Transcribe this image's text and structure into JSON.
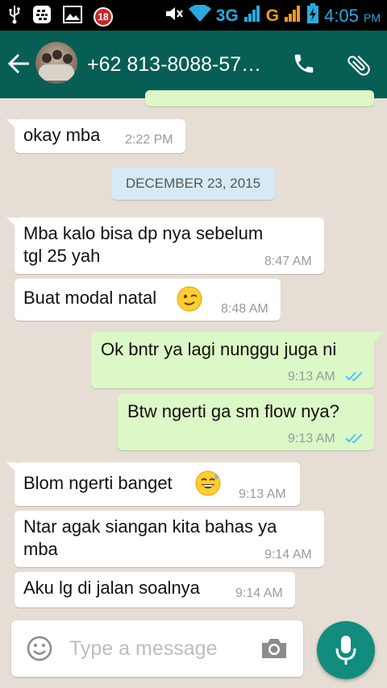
{
  "statusbar": {
    "notification_count": "18",
    "network_type_1": "3G",
    "network_type_2": "G",
    "time": "4:05",
    "ampm": "PM"
  },
  "header": {
    "contact_name": "+62 813-8088-57…"
  },
  "chat": {
    "date_separator": "DECEMBER 23, 2015",
    "messages": [
      {
        "text": "okay mba",
        "time": "2:22 PM"
      },
      {
        "text_line1": "Mba kalo bisa dp nya sebelum",
        "text_line2": "tgl 25 yah",
        "time": "8:47 AM"
      },
      {
        "text": "Buat modal natal",
        "emoji": "😉",
        "time": "8:48 AM"
      },
      {
        "text": "Ok bntr ya lagi nunggu juga ni",
        "time": "9:13 AM"
      },
      {
        "text": "Btw ngerti ga sm flow nya?",
        "time": "9:13 AM"
      },
      {
        "text": "Blom ngerti banget",
        "emoji": "😅",
        "time": "9:13 AM"
      },
      {
        "text_line1": "Ntar agak siangan kita bahas ya",
        "text_line2": "mba",
        "time": "9:14 AM"
      },
      {
        "text": "Aku lg di jalan soalnya",
        "time": "9:14 AM"
      }
    ]
  },
  "composer": {
    "placeholder": "Type a message"
  },
  "colors": {
    "header": "#075e54",
    "outgoing_bubble": "#dcf8c6",
    "incoming_bubble": "#ffffff",
    "mic_button": "#128c7e",
    "read_ticks": "#4fc3f7"
  },
  "icons": {
    "usb": "usb-icon",
    "bbm": "bbm-icon",
    "gallery": "image-icon",
    "mute": "mute-icon",
    "wifi": "wifi-icon",
    "battery": "battery-charging-icon",
    "back": "back-arrow-icon",
    "call": "phone-icon",
    "attach": "paperclip-icon",
    "emoji": "emoji-icon",
    "camera": "camera-icon",
    "mic": "mic-icon"
  }
}
